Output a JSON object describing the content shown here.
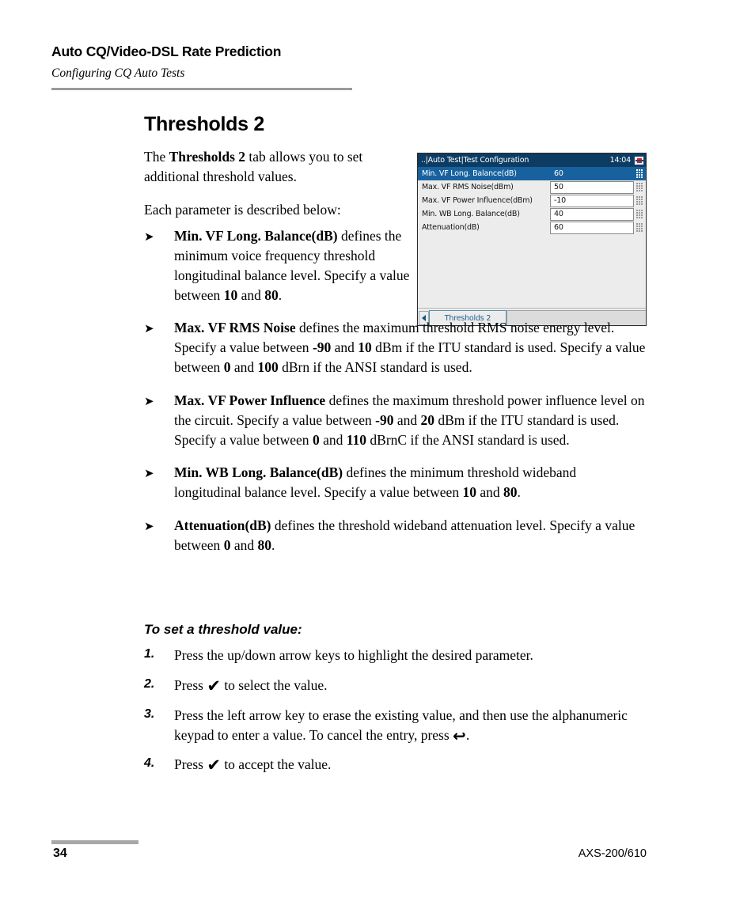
{
  "running_head": {
    "title": "Auto CQ/Video-DSL Rate Prediction",
    "subtitle": "Configuring CQ Auto Tests"
  },
  "heading": "Thresholds 2",
  "intro": {
    "p1_pre": "The ",
    "p1_bold": "Thresholds 2",
    "p1_post": " tab allows you to set additional threshold values.",
    "p2": "Each parameter is described below:"
  },
  "bullet_marker": "➤",
  "bullets": [
    {
      "term": "Min. VF Long. Balance(dB)",
      "t1": " defines the minimum voice frequency threshold longitudinal balance level. Specify a value between ",
      "b1": "10",
      "t2": " and ",
      "b2": "80",
      "t3": "."
    },
    {
      "term": "Max. VF RMS Noise",
      "t1": " defines the maximum threshold RMS noise energy level. Specify a value between ",
      "b1": "-90",
      "t2": " and ",
      "b2": "10",
      "t3": " dBm if the ITU standard is used. Specify a value between ",
      "b3": "0",
      "t4": " and ",
      "b4": "100",
      "t5": " dBrn if the ANSI standard is used."
    },
    {
      "term": "Max. VF Power Influence",
      "t1": " defines the maximum threshold power influence level on the circuit. Specify a value between ",
      "b1": "-90",
      "t2": " and ",
      "b2": "20",
      "t3": " dBm if the ITU standard is used. Specify a value between ",
      "b3": "0",
      "t4": " and ",
      "b4": "110",
      "t5": " dBrnC if the ANSI standard is used."
    },
    {
      "term": "Min. WB Long. Balance(dB)",
      "t1": " defines the minimum threshold wideband longitudinal balance level. Specify a value between ",
      "b1": "10",
      "t2": " and ",
      "b2": "80",
      "t3": "."
    },
    {
      "term": "Attenuation(dB)",
      "t1": " defines the threshold wideband attenuation level. Specify a value between ",
      "b1": "0",
      "t2": " and ",
      "b2": "80",
      "t3": "."
    }
  ],
  "procedure": {
    "heading": "To set a threshold value:",
    "steps": [
      {
        "num": "1.",
        "pre": "Press the up/down arrow keys to highlight the desired parameter.",
        "glyph": "",
        "post": ""
      },
      {
        "num": "2.",
        "pre": "Press ",
        "glyph": "✔",
        "post": " to select the value."
      },
      {
        "num": "3.",
        "pre": "Press the left arrow key to erase the existing value, and then use the alphanumeric keypad to enter a value. To cancel the entry, press ",
        "glyph": "↩",
        "post": "."
      },
      {
        "num": "4.",
        "pre": "Press ",
        "glyph": "✔",
        "post": " to accept the value."
      }
    ]
  },
  "device": {
    "title": "..|Auto Test|Test Configuration",
    "clock": "14:04",
    "status_icon": "battery-icon",
    "rows": [
      {
        "label": "Min. VF Long. Balance(dB)",
        "value": "60",
        "selected": true
      },
      {
        "label": "Max. VF RMS Noise(dBm)",
        "value": "50",
        "selected": false
      },
      {
        "label": "Max. VF Power Influence(dBm)",
        "value": "-10",
        "selected": false
      },
      {
        "label": "Min. WB Long. Balance(dB)",
        "value": "40",
        "selected": false
      },
      {
        "label": "Attenuation(dB)",
        "value": "60",
        "selected": false
      }
    ],
    "tab_active": "Thresholds 2",
    "scroll_left_icon": "chevron-left-icon",
    "colors": {
      "titlebar": "#0d3c63",
      "selected_row": "#17629e",
      "panel": "#ececec",
      "tab_text": "#1b5f90"
    }
  },
  "footer": {
    "page_number": "34",
    "model": "AXS-200/610"
  }
}
